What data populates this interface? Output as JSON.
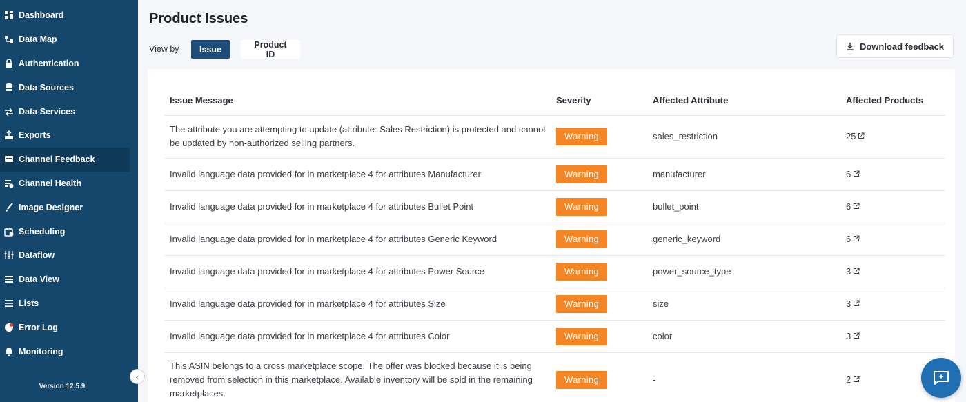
{
  "sidebar": {
    "items": [
      {
        "label": "Dashboard",
        "icon": "dashboard-icon"
      },
      {
        "label": "Data Map",
        "icon": "data-map-icon"
      },
      {
        "label": "Authentication",
        "icon": "lock-icon"
      },
      {
        "label": "Data Sources",
        "icon": "database-icon"
      },
      {
        "label": "Data Services",
        "icon": "swap-icon"
      },
      {
        "label": "Exports",
        "icon": "export-icon"
      },
      {
        "label": "Channel Feedback",
        "icon": "feedback-icon",
        "active": true
      },
      {
        "label": "Channel Health",
        "icon": "health-icon"
      },
      {
        "label": "Image Designer",
        "icon": "brush-icon"
      },
      {
        "label": "Scheduling",
        "icon": "calendar-icon"
      },
      {
        "label": "Dataflow",
        "icon": "dataflow-icon"
      },
      {
        "label": "Data View",
        "icon": "data-view-icon"
      },
      {
        "label": "Lists",
        "icon": "list-icon"
      },
      {
        "label": "Error Log",
        "icon": "error-icon"
      },
      {
        "label": "Monitoring",
        "icon": "bell-icon"
      }
    ],
    "version": "Version 12.5.9"
  },
  "header": {
    "title": "Product Issues",
    "view_by_label": "View by",
    "toggle_issue": "Issue",
    "toggle_product_id": "Product ID",
    "download_label": "Download feedback"
  },
  "table": {
    "columns": [
      "Issue Message",
      "Severity",
      "Affected Attribute",
      "Affected Products"
    ],
    "rows": [
      {
        "message": "The attribute you are attempting to update (attribute: Sales Restriction) is protected and cannot be updated by non-authorized selling partners.",
        "severity": "Warning",
        "attribute": "sales_restriction",
        "products": "25"
      },
      {
        "message": "Invalid language data provided for in marketplace 4 for attributes Manufacturer",
        "severity": "Warning",
        "attribute": "manufacturer",
        "products": "6"
      },
      {
        "message": "Invalid language data provided for in marketplace 4 for attributes Bullet Point",
        "severity": "Warning",
        "attribute": "bullet_point",
        "products": "6"
      },
      {
        "message": "Invalid language data provided for in marketplace 4 for attributes Generic Keyword",
        "severity": "Warning",
        "attribute": "generic_keyword",
        "products": "6"
      },
      {
        "message": "Invalid language data provided for in marketplace 4 for attributes Power Source",
        "severity": "Warning",
        "attribute": "power_source_type",
        "products": "3"
      },
      {
        "message": "Invalid language data provided for in marketplace 4 for attributes Size",
        "severity": "Warning",
        "attribute": "size",
        "products": "3"
      },
      {
        "message": "Invalid language data provided for in marketplace 4 for attributes Color",
        "severity": "Warning",
        "attribute": "color",
        "products": "3"
      },
      {
        "message": "This ASIN belongs to a cross marketplace scope. The offer was blocked because it is being removed from selection in this marketplace. Available inventory will be sold in the remaining marketplaces.",
        "severity": "Warning",
        "attribute": "-",
        "products": "2"
      }
    ]
  },
  "colors": {
    "sidebar_bg": "#14476b",
    "accent": "#1f4c78",
    "warning": "#f68523",
    "chat_fab": "#1f6fb2"
  }
}
